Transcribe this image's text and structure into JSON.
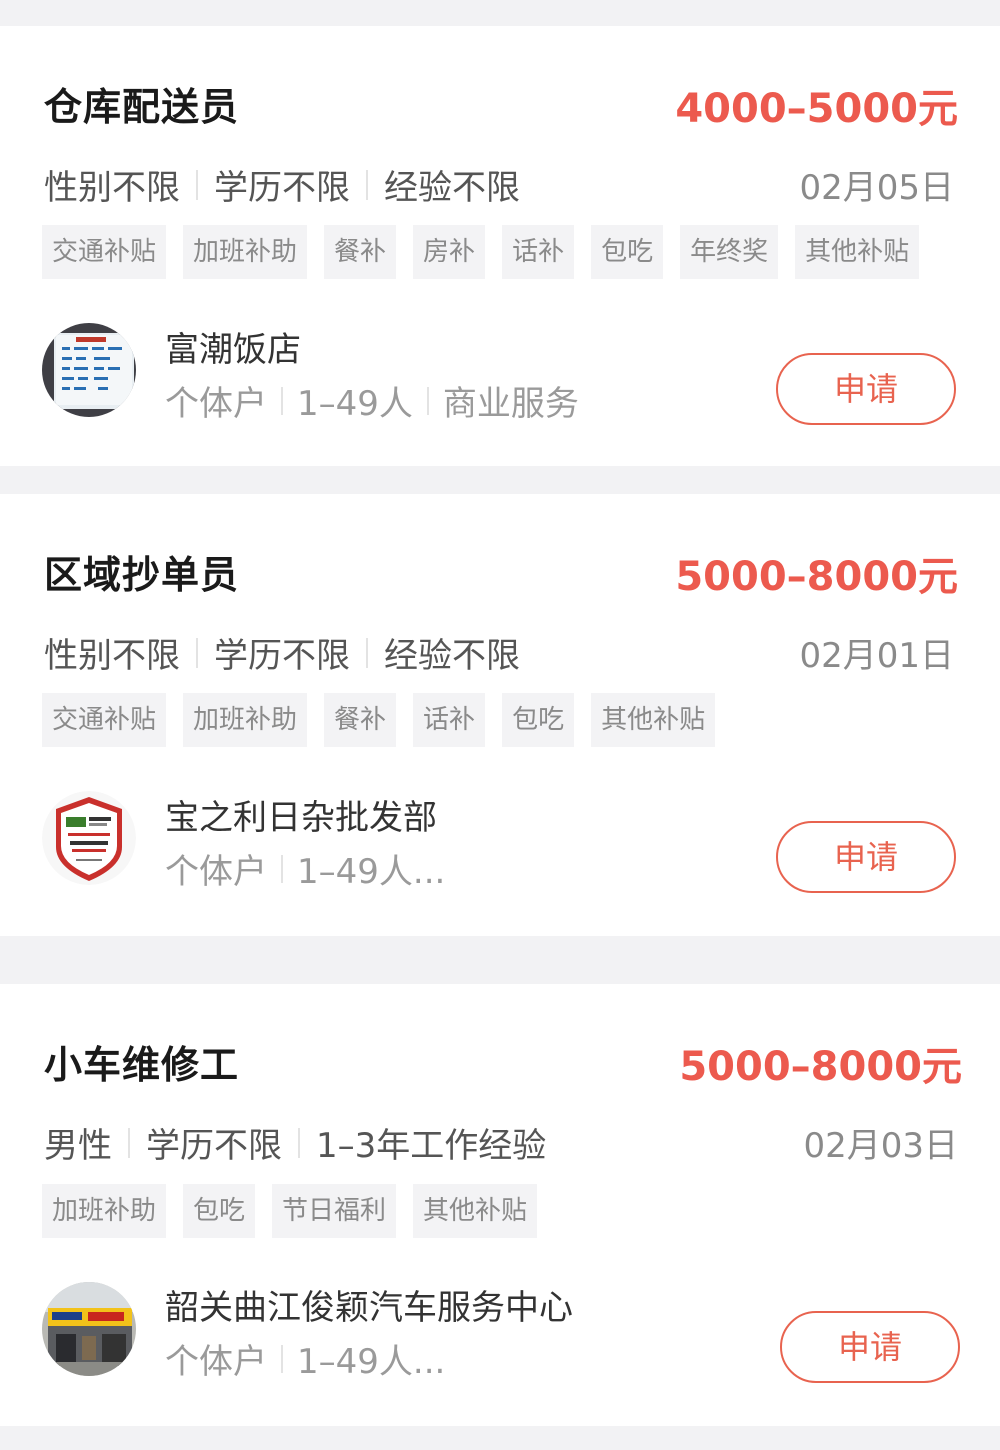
{
  "jobs": [
    {
      "title": "仓库配送员",
      "salary": "4000–5000元",
      "requirements": [
        "性别不限",
        "学历不限",
        "经验不限"
      ],
      "date": "02月05日",
      "tags": [
        "交通补贴",
        "加班补助",
        "餐补",
        "房补",
        "话补",
        "包吃",
        "年终奖",
        "其他补贴"
      ],
      "company": "富潮饭店",
      "company_meta": [
        "个体户",
        "1–49人",
        "商业服务"
      ],
      "apply_label": "申请"
    },
    {
      "title": "区域抄单员",
      "salary": "5000–8000元",
      "requirements": [
        "性别不限",
        "学历不限",
        "经验不限"
      ],
      "date": "02月01日",
      "tags": [
        "交通补贴",
        "加班补助",
        "餐补",
        "话补",
        "包吃",
        "其他补贴"
      ],
      "company": "宝之利日杂批发部",
      "company_meta": [
        "个体户",
        "1–49人..."
      ],
      "apply_label": "申请"
    },
    {
      "title": "小车维修工",
      "salary": "5000–8000元",
      "requirements": [
        "男性",
        "学历不限",
        "1–3年工作经验"
      ],
      "date": "02月03日",
      "tags": [
        "加班补助",
        "包吃",
        "节日福利",
        "其他补贴"
      ],
      "company": "韶关曲江俊颖汽车服务中心",
      "company_meta": [
        "个体户",
        "1–49人..."
      ],
      "apply_label": "申请"
    }
  ],
  "colors": {
    "salary": "#ec5a4e",
    "apply": "#e8634f",
    "background": "#f2f2f4"
  }
}
